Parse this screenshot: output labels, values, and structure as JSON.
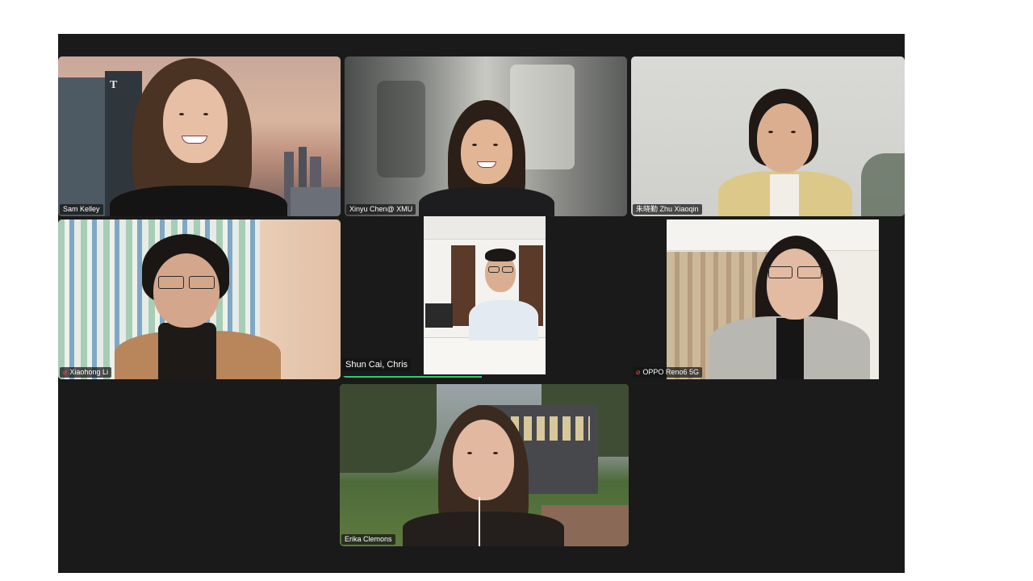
{
  "meeting": {
    "participants": [
      {
        "name": "Sam Kelley",
        "muted": false
      },
      {
        "name": "Xinyu Chen@ XMU",
        "muted": false
      },
      {
        "name": "朱晓勤 Zhu Xiaoqin",
        "muted": false
      },
      {
        "name": "Xiaohong Li",
        "muted": true
      },
      {
        "name": "Shun Cai, Chris",
        "muted": false
      },
      {
        "name": "OPPO Reno6 5G",
        "muted": true
      },
      {
        "name": "Erika Clemons",
        "muted": false
      }
    ]
  },
  "icons": {
    "muted_mic": "mic-off-icon"
  },
  "colors": {
    "grid_background": "#1a1a1a",
    "muted_icon": "#e5484d",
    "active_speaker": "#2ecc71"
  }
}
